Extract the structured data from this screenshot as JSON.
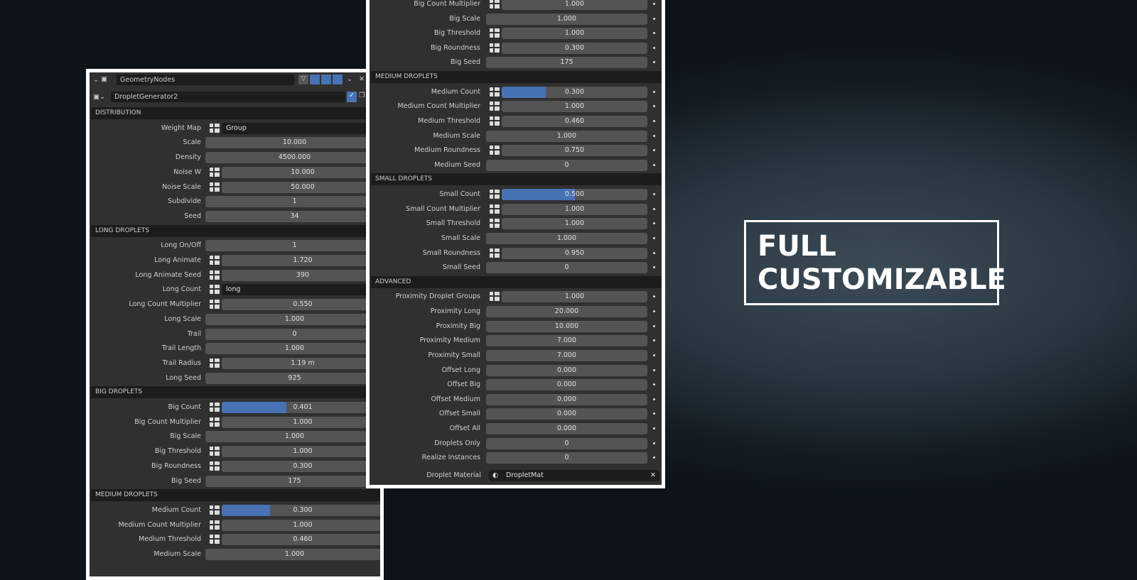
{
  "header": {
    "editor": "GeometryNodes",
    "modifier": "DropletGenerator2"
  },
  "left": [
    {
      "h": "DISTRIBUTION"
    },
    {
      "l": "Weight Map",
      "i": 1,
      "v": "Group",
      "s": 1
    },
    {
      "l": "Scale",
      "v": "10.000"
    },
    {
      "l": "Density",
      "v": "4500.000"
    },
    {
      "l": "Noise W",
      "i": 1,
      "v": "10.000"
    },
    {
      "l": "Noise Scale",
      "i": 1,
      "v": "50.000"
    },
    {
      "l": "Subdivide",
      "v": "1"
    },
    {
      "l": "Seed",
      "v": "34"
    },
    {
      "h": "LONG DROPLETS"
    },
    {
      "l": "Long On/Off",
      "v": "1"
    },
    {
      "l": "Long Animate",
      "i": 1,
      "v": "1.720"
    },
    {
      "l": "Long Animate Seed",
      "i": 1,
      "v": "390"
    },
    {
      "l": "Long Count",
      "i": 1,
      "v": "long",
      "s": 1
    },
    {
      "l": "Long Count Multiplier",
      "i": 1,
      "v": "0.550"
    },
    {
      "l": "Long Scale",
      "v": "1.000"
    },
    {
      "l": "Trail",
      "v": "0"
    },
    {
      "l": "Trail Length",
      "v": "1.000"
    },
    {
      "l": "Trail Radius",
      "i": 1,
      "v": "1.19 m"
    },
    {
      "l": "Long Seed",
      "v": "925"
    },
    {
      "h": "BIG DROPLETS"
    },
    {
      "l": "Big Count",
      "i": 1,
      "v": "0.401",
      "f": 0.401
    },
    {
      "l": "Big Count Multiplier",
      "i": 1,
      "v": "1.000"
    },
    {
      "l": "Big Scale",
      "v": "1.000"
    },
    {
      "l": "Big Threshold",
      "i": 1,
      "v": "1.000"
    },
    {
      "l": "Big Roundness",
      "i": 1,
      "v": "0.300"
    },
    {
      "l": "Big Seed",
      "v": "175"
    },
    {
      "h": "MEDIUM DROPLETS"
    },
    {
      "l": "Medium Count",
      "i": 1,
      "v": "0.300",
      "f": 0.3
    },
    {
      "l": "Medium Count Multiplier",
      "i": 1,
      "v": "1.000"
    },
    {
      "l": "Medium Threshold",
      "i": 1,
      "v": "0.460"
    },
    {
      "l": "Medium Scale",
      "v": "1.000"
    }
  ],
  "right": [
    {
      "l": "Big Count Multiplier",
      "i": 1,
      "v": "1.000"
    },
    {
      "l": "Big Scale",
      "v": "1.000"
    },
    {
      "l": "Big Threshold",
      "i": 1,
      "v": "1.000"
    },
    {
      "l": "Big Roundness",
      "i": 1,
      "v": "0.300"
    },
    {
      "l": "Big Seed",
      "v": "175"
    },
    {
      "h": "MEDIUM DROPLETS"
    },
    {
      "l": "Medium Count",
      "i": 1,
      "v": "0.300",
      "f": 0.3
    },
    {
      "l": "Medium Count Multiplier",
      "i": 1,
      "v": "1.000"
    },
    {
      "l": "Medium Threshold",
      "i": 1,
      "v": "0.460"
    },
    {
      "l": "Medium Scale",
      "v": "1.000"
    },
    {
      "l": "Medium Roundness",
      "i": 1,
      "v": "0.750"
    },
    {
      "l": "Medium Seed",
      "v": "0"
    },
    {
      "h": "SMALL DROPLETS"
    },
    {
      "l": "Small Count",
      "i": 1,
      "v": "0.500",
      "f": 0.5
    },
    {
      "l": "Small Count Multiplier",
      "i": 1,
      "v": "1.000"
    },
    {
      "l": "Small Threshold",
      "i": 1,
      "v": "1.000"
    },
    {
      "l": "Small Scale",
      "v": "1.000"
    },
    {
      "l": "Small Roundness",
      "i": 1,
      "v": "0.950"
    },
    {
      "l": "Small Seed",
      "v": "0"
    },
    {
      "h": "ADVANCED"
    },
    {
      "l": "Proximity Droplet Groups",
      "i": 1,
      "v": "1.000"
    },
    {
      "l": "Proximity Long",
      "v": "20.000"
    },
    {
      "l": "Proximity Big",
      "v": "10.000"
    },
    {
      "l": "Proximity Medium",
      "v": "7.000"
    },
    {
      "l": "Proximity Small",
      "v": "7.000"
    },
    {
      "l": "Offset Long",
      "v": "0.000"
    },
    {
      "l": "Offset Big",
      "v": "0.000"
    },
    {
      "l": "Offset Medium",
      "v": "0.000"
    },
    {
      "l": "Offset Small",
      "v": "0.000"
    },
    {
      "l": "Offset All",
      "v": "0.000"
    },
    {
      "l": "Droplets Only",
      "v": "0"
    },
    {
      "l": "Realize Instances",
      "v": "0"
    }
  ],
  "material": {
    "label": "Droplet Material",
    "value": "DropletMat"
  },
  "banner": {
    "line1": "FULL",
    "line2": "CUSTOMIZABLE"
  }
}
